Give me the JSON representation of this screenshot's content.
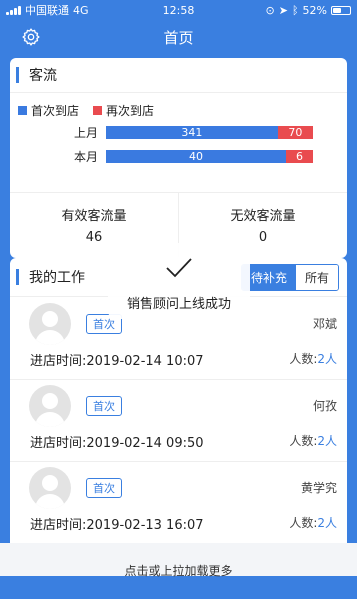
{
  "status_bar": {
    "carrier": "中国联通",
    "network": "4G",
    "time": "12:58",
    "battery": "52%",
    "battery_level": 0.52
  },
  "header": {
    "title": "首页"
  },
  "traffic": {
    "title": "客流",
    "legend": [
      {
        "label": "首次到店",
        "color": "#3a7ae0"
      },
      {
        "label": "再次到店",
        "color": "#e94b4f"
      }
    ],
    "rows": [
      {
        "label": "上月",
        "first": 341,
        "repeat": 70
      },
      {
        "label": "本月",
        "first": 40,
        "repeat": 6
      }
    ],
    "valid_label": "有效客流量",
    "valid_value": "46",
    "invalid_label": "无效客流量",
    "invalid_value": "0"
  },
  "chart_data": {
    "type": "bar",
    "categories": [
      "上月",
      "本月"
    ],
    "series": [
      {
        "name": "首次到店",
        "values": [
          341,
          40
        ]
      },
      {
        "name": "再次到店",
        "values": [
          70,
          6
        ]
      }
    ],
    "stacked": "percent",
    "legend": "top-left"
  },
  "work": {
    "title": "我的工作",
    "tabs": [
      {
        "label": "待补充",
        "active": true
      },
      {
        "label": "所有",
        "active": false
      }
    ],
    "items": [
      {
        "tag": "首次",
        "name": "邓斌",
        "time": "进店时间:2019-02-14 10:07",
        "count_label": "人数:",
        "count_value": "2人"
      },
      {
        "tag": "首次",
        "name": "何孜",
        "time": "进店时间:2019-02-14 09:50",
        "count_label": "人数:",
        "count_value": "2人"
      },
      {
        "tag": "首次",
        "name": "黄学究",
        "time": "进店时间:2019-02-13 16:07",
        "count_label": "人数:",
        "count_value": "2人"
      }
    ]
  },
  "toast": {
    "message": "销售顾问上线成功"
  },
  "load_more": "点击或上拉加载更多"
}
